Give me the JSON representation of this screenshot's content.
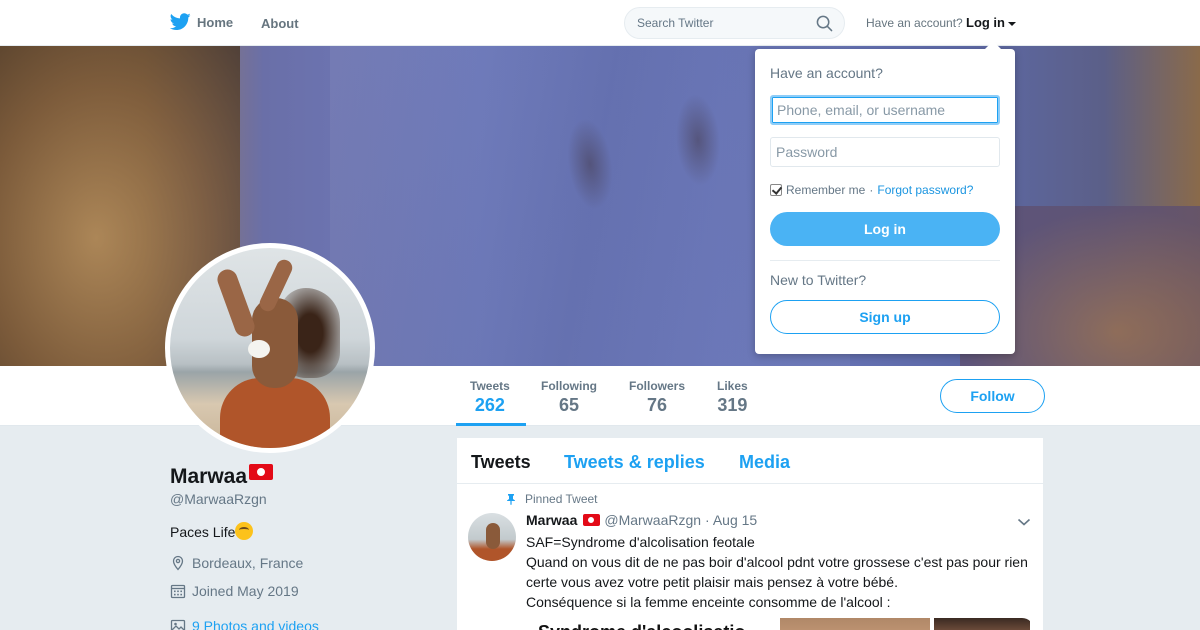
{
  "nav": {
    "home_label": "Home",
    "about_label": "About",
    "search_placeholder": "Search Twitter",
    "have_account_text": "Have an account?",
    "login_label": "Log in"
  },
  "colors": {
    "accent": "#1da1f2",
    "login_button": "#4ab3f4"
  },
  "profile": {
    "name": "Marwaa",
    "handle": "@MarwaaRzgn",
    "bio": "Paces Life",
    "location": "Bordeaux, France",
    "joined": "Joined May 2019",
    "photos_link": "9 Photos and videos",
    "follow_label": "Follow"
  },
  "stats": [
    {
      "label": "Tweets",
      "value": "262",
      "active": true
    },
    {
      "label": "Following",
      "value": "65",
      "active": false
    },
    {
      "label": "Followers",
      "value": "76",
      "active": false
    },
    {
      "label": "Likes",
      "value": "319",
      "active": false
    }
  ],
  "timeline": {
    "tabs": [
      "Tweets",
      "Tweets & replies",
      "Media"
    ],
    "active_tab": "Tweets"
  },
  "pinned_tweet": {
    "pinned_label": "Pinned Tweet",
    "author_name": "Marwaa",
    "author_handle": "@MarwaaRzgn",
    "date": "· Aug 15",
    "lines": [
      "SAF=Syndrome d'alcolisation feotale",
      "Quand on vous dit de ne pas boir d'alcool pdnt votre grossese c'est pas pour rien certe vous avez votre petit plaisir mais pensez à votre bébé.",
      "Conséquence si la femme enceinte consomme de l'alcool :"
    ],
    "media_heading": "Syndrome d'alcoolisatio"
  },
  "login_dropdown": {
    "title": "Have an account?",
    "username_placeholder": "Phone, email, or username",
    "password_placeholder": "Password",
    "remember_label": "Remember me",
    "separator": "·",
    "forgot_label": "Forgot password?",
    "login_button": "Log in",
    "new_text": "New to Twitter?",
    "signup_button": "Sign up"
  }
}
